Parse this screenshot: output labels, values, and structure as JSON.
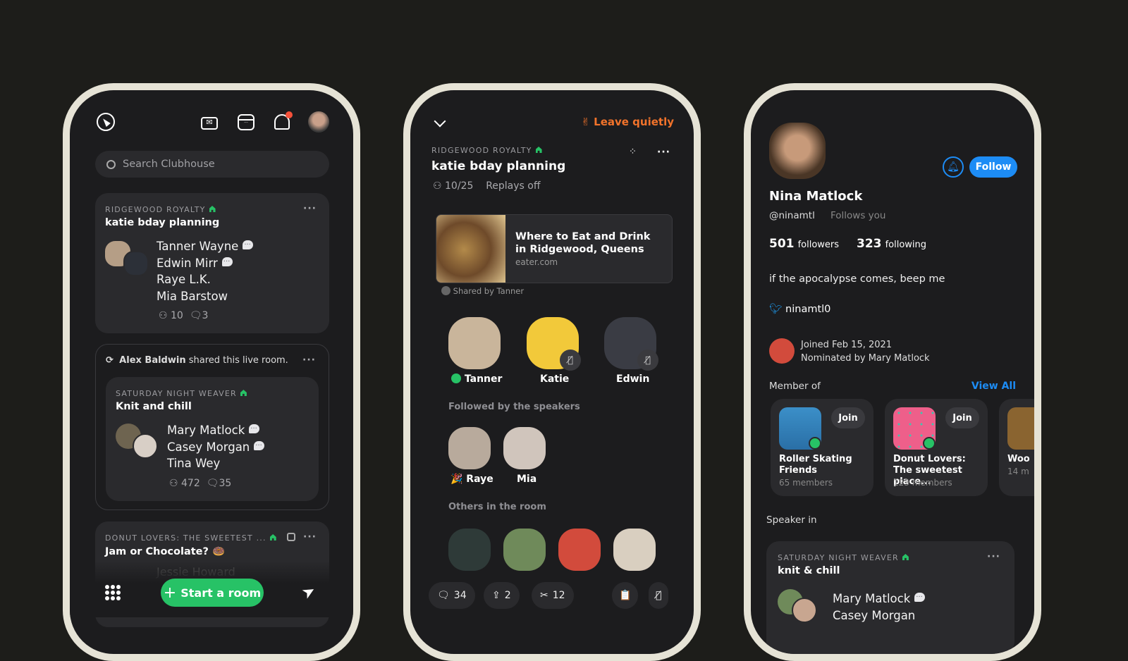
{
  "colors": {
    "accent_green": "#27c266",
    "follow_blue": "#1d8cf5",
    "leave_orange": "#f2732b",
    "frame": "#e6e3d6",
    "screen": "#1c1c1e"
  },
  "hallway": {
    "icons": [
      "explore-icon",
      "new-message-icon",
      "calendar-icon",
      "notifications-icon",
      "profile-avatar"
    ],
    "search_placeholder": "Search Clubhouse",
    "rooms": [
      {
        "club": "RIDGEWOOD ROYALTY",
        "title": "katie bday planning",
        "speakers": [
          "Tanner Wayne",
          "Edwin Mirr",
          "Raye L.K.",
          "Mia Barstow"
        ],
        "listeners": "10",
        "chats": "3"
      },
      {
        "shared_by": "Alex Baldwin",
        "shared_text": "shared this live room.",
        "club": "SATURDAY NIGHT WEAVER",
        "title": "Knit and chill",
        "speakers": [
          "Mary Matlock",
          "Casey Morgan",
          "Tina Wey"
        ],
        "listeners": "472",
        "chats": "35"
      },
      {
        "club": "DONUT LOVERS: THE SWEETEST ...",
        "title": "Jam or Chocolate? 🍩",
        "speakers": [
          "Jessie Howard"
        ]
      }
    ],
    "start_room": "Start a room"
  },
  "room": {
    "leave": "✌ Leave quietly",
    "club": "RIDGEWOOD ROYALTY",
    "title": "katie bday planning",
    "count": "10/25",
    "replays": "Replays off",
    "link": {
      "title": "Where to Eat and Drink in Ridgewood, Queens",
      "domain": "eater.com",
      "shared_by": "Shared by Tanner"
    },
    "speakers": [
      {
        "name": "Tanner",
        "moderator": true
      },
      {
        "name": "Katie",
        "muted": true
      },
      {
        "name": "Edwin",
        "muted": true
      }
    ],
    "followed_label": "Followed by the speakers",
    "followed": [
      {
        "name": "🎉 Raye"
      },
      {
        "name": "Mia"
      }
    ],
    "others_label": "Others in the room",
    "actions": {
      "chat": "34",
      "share": "2",
      "clips": "12"
    }
  },
  "profile": {
    "name": "Nina Matlock",
    "handle": "@ninamtl",
    "follows_you": "Follows you",
    "follow_button": "Follow",
    "followers": "501",
    "followers_label": "followers",
    "following": "323",
    "following_label": "following",
    "bio": "if the apocalypse comes, beep me",
    "twitter": "ninamtl0",
    "joined": "Joined Feb 15, 2021",
    "nominated": "Nominated by Mary Matlock",
    "member_of": "Member of",
    "view_all": "View All",
    "clubs": [
      {
        "name": "Roller Skating Friends",
        "members": "65 members",
        "join": "Join"
      },
      {
        "name": "Donut Lovers: The sweetest place...",
        "members": "123 members",
        "join": "Join"
      },
      {
        "name": "Woo",
        "members": "14 m"
      }
    ],
    "speaker_in": "Speaker in",
    "speaker_room": {
      "club": "SATURDAY NIGHT WEAVER",
      "title": "knit & chill",
      "speakers": [
        "Mary Matlock",
        "Casey Morgan"
      ]
    }
  }
}
